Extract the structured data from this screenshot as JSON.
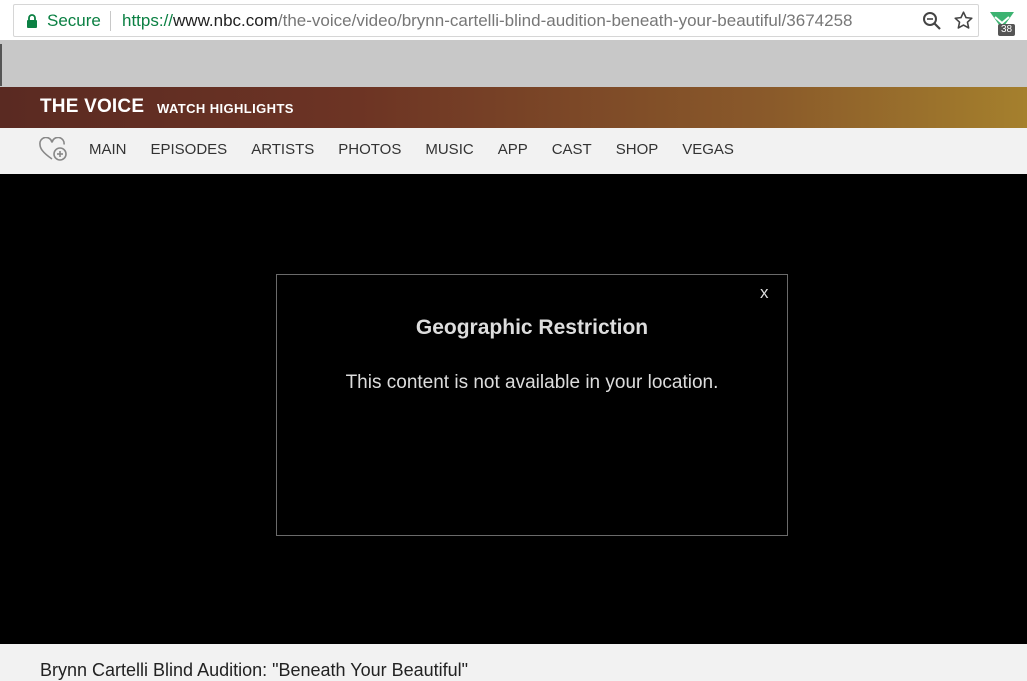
{
  "browser": {
    "secure_label": "Secure",
    "url_scheme": "https://",
    "url_host": "www.nbc.com",
    "url_path": "/the-voice/video/brynn-cartelli-blind-audition-beneath-your-beautiful/3674258",
    "extension_badge": "38",
    "icons": [
      "lock-icon",
      "zoom-icon",
      "star-icon",
      "extension-icon"
    ],
    "secure_color": "#0b8043"
  },
  "show_header": {
    "title": "THE VOICE",
    "subtitle": "WATCH HIGHLIGHTS"
  },
  "nav": {
    "favorite_icon": "heart-plus-icon",
    "items": [
      "MAIN",
      "EPISODES",
      "ARTISTS",
      "PHOTOS",
      "MUSIC",
      "APP",
      "CAST",
      "SHOP",
      "VEGAS"
    ]
  },
  "modal": {
    "close_label": "x",
    "title": "Geographic Restriction",
    "message": "This content is not available in your location."
  },
  "video": {
    "title": "Brynn Cartelli Blind Audition: \"Beneath Your Beautiful\""
  }
}
